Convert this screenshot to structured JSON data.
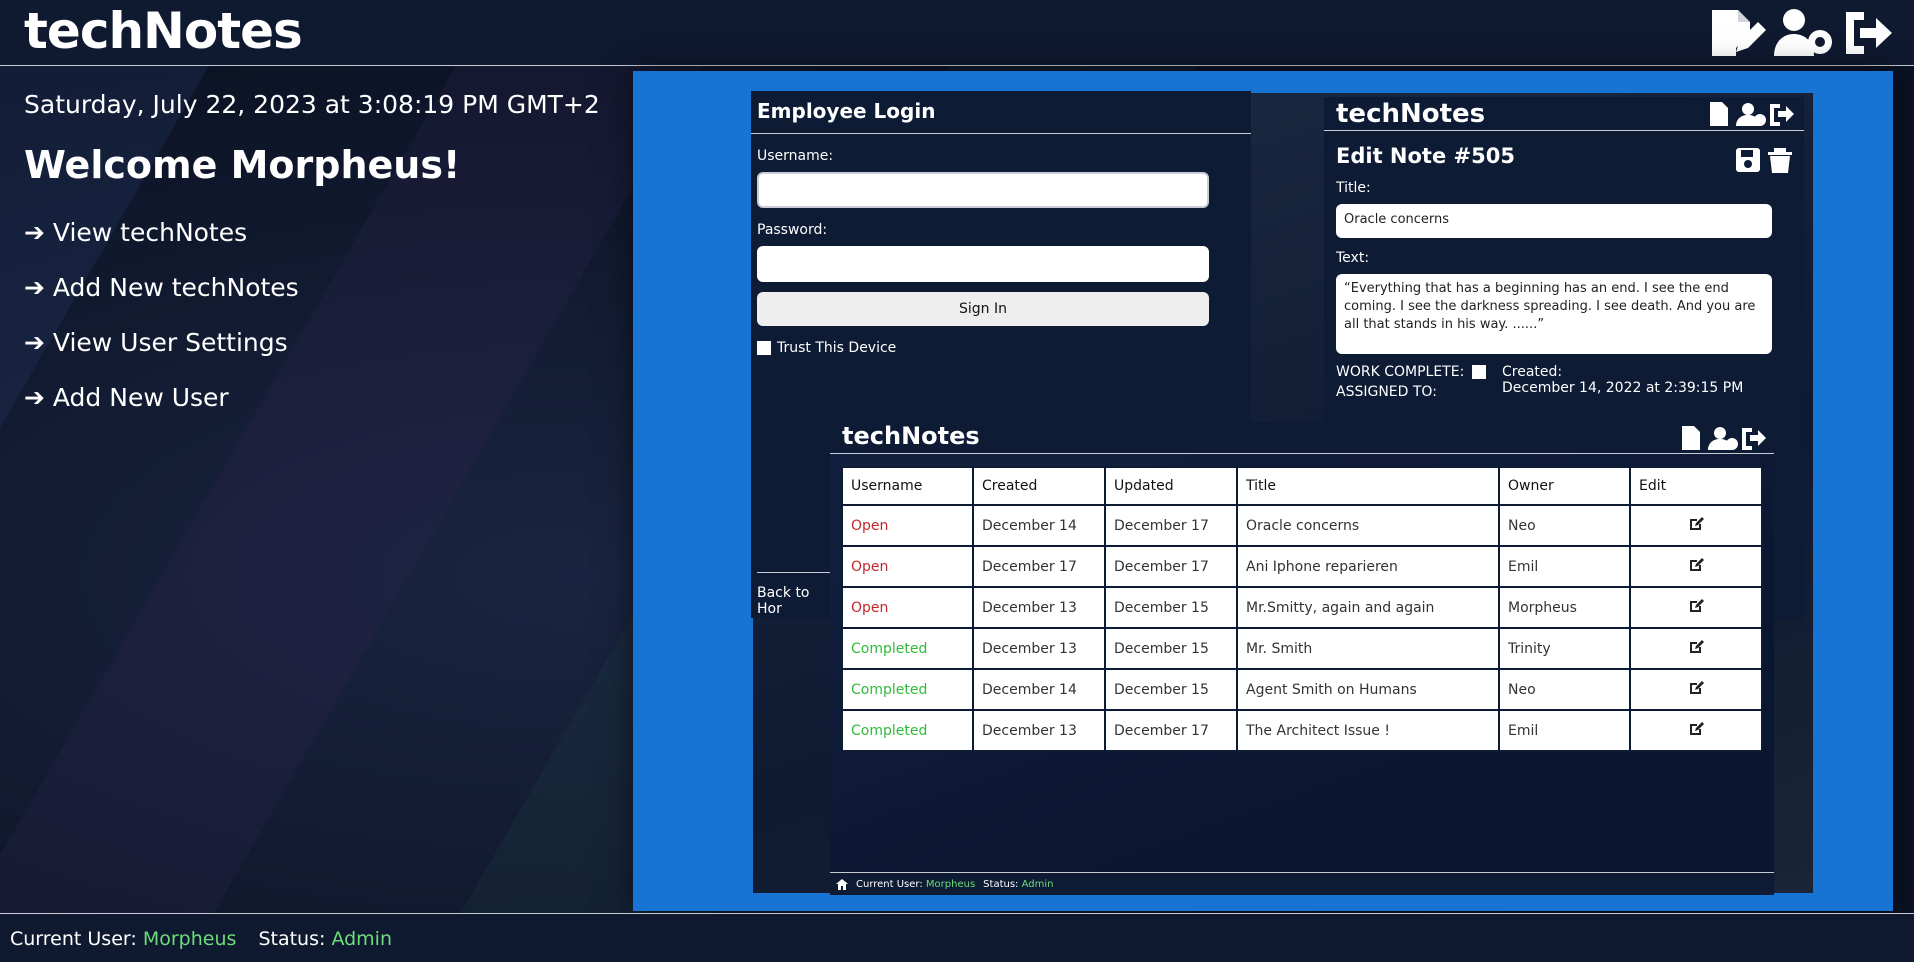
{
  "app": {
    "brand": "techNotes"
  },
  "main": {
    "datetime": "Saturday, July 22, 2023 at 3:08:19 PM GMT+2",
    "welcome": "Welcome Morpheus!",
    "nav": [
      "➔ View techNotes",
      "➔ Add New techNotes",
      "➔ View User Settings",
      "➔ Add New User"
    ]
  },
  "footer": {
    "user_label": "Current User:",
    "user": "Morpheus",
    "status_label": "Status:",
    "status": "Admin"
  },
  "login": {
    "title": "Employee Login",
    "username_label": "Username:",
    "password_label": "Password:",
    "signin": "Sign In",
    "trust": "Trust This Device",
    "back": "Back to Hor"
  },
  "edit": {
    "brand": "techNotes",
    "title": "Edit Note #505",
    "title_label": "Title:",
    "title_value": "Oracle concerns",
    "text_label": "Text:",
    "text_value": "“Everything that has a beginning has an end. I see the end coming. I see the darkness spreading. I see death. And you are all that stands in his way. ......”",
    "work_complete": "WORK COMPLETE:",
    "assigned": "ASSIGNED TO:",
    "created_label": "Created:",
    "created_value": "December 14, 2022 at 2:39:15 PM"
  },
  "list": {
    "brand": "techNotes",
    "headers": [
      "Username",
      "Created",
      "Updated",
      "Title",
      "Owner",
      "Edit"
    ],
    "rows": [
      {
        "status": "Open",
        "created": "December 14",
        "updated": "December 17",
        "title": "Oracle concerns",
        "owner": "Neo"
      },
      {
        "status": "Open",
        "created": "December 17",
        "updated": "December 17",
        "title": "Ani Iphone reparieren",
        "owner": "Emil"
      },
      {
        "status": "Open",
        "created": "December 13",
        "updated": "December 15",
        "title": "Mr.Smitty, again and again",
        "owner": "Morpheus"
      },
      {
        "status": "Completed",
        "created": "December 13",
        "updated": "December 15",
        "title": "Mr. Smith",
        "owner": "Trinity"
      },
      {
        "status": "Completed",
        "created": "December 14",
        "updated": "December 15",
        "title": "Agent Smith on Humans",
        "owner": "Neo"
      },
      {
        "status": "Completed",
        "created": "December 13",
        "updated": "December 17",
        "title": "The Architect Issue !",
        "owner": "Emil"
      }
    ],
    "footer": {
      "user_label": "Current User:",
      "user": "Morpheus",
      "status_label": "Status:",
      "status": "Admin"
    }
  },
  "colors": {
    "accent_green": "#6fdc7b",
    "panel_blue": "#1874d2",
    "open_red": "#c0282c",
    "completed_green": "#2fbb3a"
  }
}
